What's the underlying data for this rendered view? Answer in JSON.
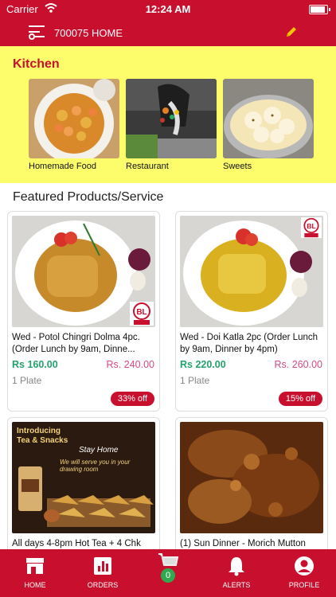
{
  "status_bar": {
    "carrier": "Carrier",
    "time": "12:24 AM"
  },
  "header": {
    "location": "700075 HOME",
    "menu_icon": "filter-menu-icon",
    "edit_icon": "pencil-icon"
  },
  "kitchen": {
    "title": "Kitchen",
    "categories": [
      {
        "label": "Homemade Food"
      },
      {
        "label": "Restaurant"
      },
      {
        "label": "Sweets"
      }
    ]
  },
  "featured": {
    "title": "Featured Products/Service",
    "products": [
      {
        "name": "Wed - Potol Chingri Dolma 4pc. (Order Lunch by 9am, Dinne...",
        "price": "Rs 160.00",
        "mrp": "Rs. 240.00",
        "unit": "1 Plate",
        "discount": "33% off"
      },
      {
        "name": "Wed - Doi Katla 2pc (Order Lunch by 9am, Dinner by 4pm)",
        "price": "Rs 220.00",
        "mrp": "Rs. 260.00",
        "unit": "1 Plate",
        "discount": "15% off"
      },
      {
        "name": "All days 4-8pm Hot Tea + 4 Chk",
        "promo_title": "Introducing Tea & Snacks",
        "promo_sub": "Stay Home",
        "promo_line": "We will serve you in your drawing room"
      },
      {
        "name": "(1) Sun Dinner - Morich Mutton"
      }
    ]
  },
  "tab_bar": {
    "items": [
      {
        "label": "HOME"
      },
      {
        "label": "ORDERS"
      },
      {
        "label": "ALERTS"
      },
      {
        "label": "PROFILE"
      }
    ],
    "cart_count": "0"
  },
  "colors": {
    "brand_red": "#c8102e",
    "kitchen_bg": "#fdfd6b",
    "price_green": "#22a36b",
    "mrp_pink": "#d24a86"
  }
}
